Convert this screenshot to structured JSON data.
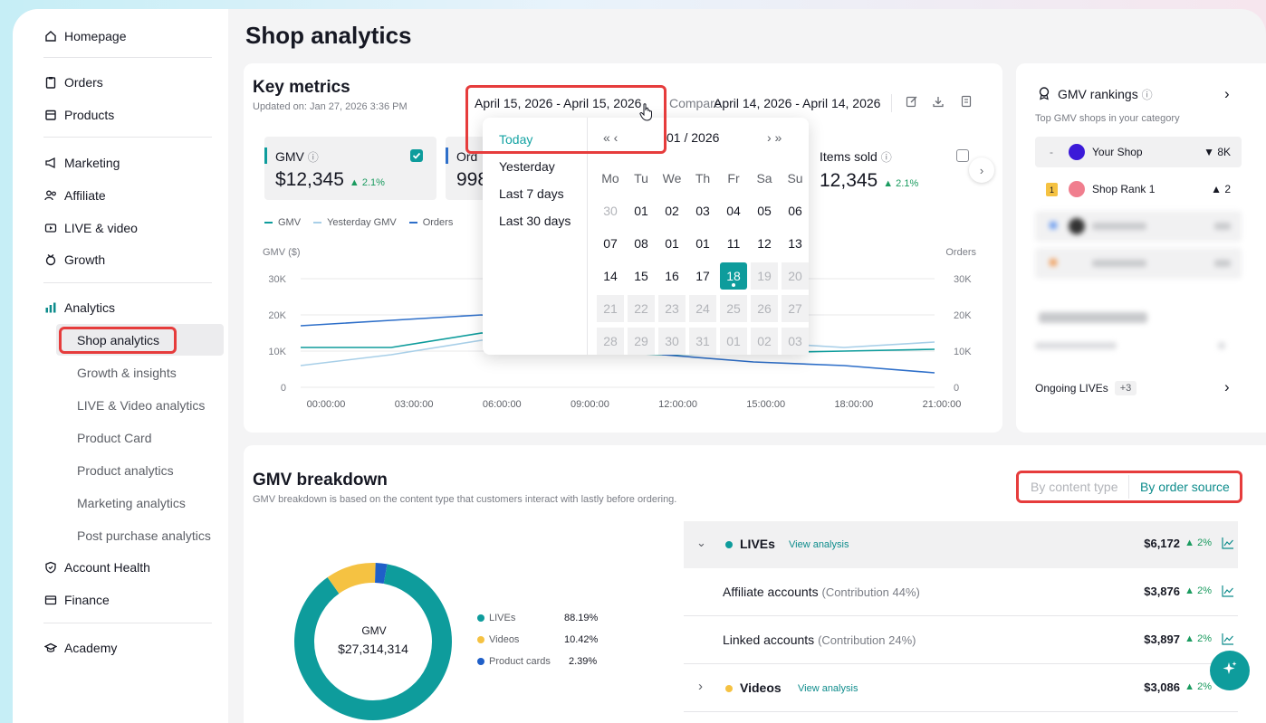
{
  "sidebar": {
    "homepage": "Homepage",
    "orders": "Orders",
    "products": "Products",
    "marketing": "Marketing",
    "affiliate": "Affiliate",
    "live_video": "LIVE & video",
    "growth": "Growth",
    "analytics": "Analytics",
    "analytics_items": [
      "Shop analytics",
      "Growth & insights",
      "LIVE & Video analytics",
      "Product Card",
      "Product analytics",
      "Marketing analytics",
      "Post purchase analytics"
    ],
    "account_health": "Account Health",
    "finance": "Finance",
    "academy": "Academy"
  },
  "page_title": "Shop analytics",
  "key_metrics": {
    "title": "Key metrics",
    "updated": "Updated on: Jan 27, 2026 3:36 PM",
    "date_range": "April 15, 2026 - April 15, 2026",
    "compare_label": "Compare",
    "compare_range": "April 14, 2026 - April 14, 2026",
    "gmv_label": "GMV",
    "gmv_value": "$12,345",
    "gmv_change": "▲ 2.1%",
    "orders_label": "Ord",
    "orders_value": "998",
    "items_label": "Items sold",
    "items_value": "12,345",
    "items_change": "▲ 2.1%",
    "legend": [
      "GMV",
      "Yesterday GMV",
      "Orders"
    ]
  },
  "chart_data": {
    "type": "line",
    "ylabel": "GMV ($)",
    "y2label": "Orders",
    "y_ticks": [
      "30K",
      "20K",
      "10K",
      "0"
    ],
    "y2_ticks": [
      "30K",
      "20K",
      "10K",
      "0"
    ],
    "ylim": [
      0,
      30000
    ],
    "x": [
      "00:00:00",
      "03:00:00",
      "06:00:00",
      "09:00:00",
      "12:00:00",
      "15:00:00",
      "18:00:00",
      "21:00:00"
    ],
    "series": [
      {
        "name": "GMV",
        "color": "#0e9c9c",
        "values": [
          11000,
          11000,
          15000,
          10000,
          9000,
          9500,
          10000,
          10500
        ]
      },
      {
        "name": "Yesterday GMV",
        "color": "#a8cfe8",
        "values": [
          6000,
          9000,
          13000,
          14000,
          13500,
          12500,
          11000,
          12500
        ]
      },
      {
        "name": "Orders",
        "color": "#2e6fc9",
        "values": [
          17000,
          18500,
          20000,
          14000,
          9000,
          7000,
          6000,
          4000
        ]
      }
    ]
  },
  "date_picker": {
    "quick_options": [
      "Today",
      "Yesterday",
      "Last 7 days",
      "Last 30 days"
    ],
    "nav_prev": "« ‹",
    "nav_next": "› »",
    "month": "01 / 2026",
    "weekdays": [
      "Mo",
      "Tu",
      "We",
      "Th",
      "Fr",
      "Sa",
      "Su"
    ],
    "rows": [
      [
        "30",
        "01",
        "02",
        "03",
        "04",
        "05",
        "06"
      ],
      [
        "07",
        "08",
        "01",
        "01",
        "11",
        "12",
        "13"
      ],
      [
        "14",
        "15",
        "16",
        "17",
        "18",
        "19",
        "20"
      ],
      [
        "21",
        "22",
        "23",
        "24",
        "25",
        "26",
        "27"
      ],
      [
        "28",
        "29",
        "30",
        "31",
        "01",
        "02",
        "03"
      ]
    ]
  },
  "gmv_rankings": {
    "title": "GMV rankings",
    "subtitle": "Top GMV shops in your category",
    "your_shop": "Your Shop",
    "your_shop_prefix": "-",
    "your_shop_change": "▼ 8K",
    "rank1": "Shop Rank 1",
    "rank1_badge": "1",
    "rank1_change": "▲ 2",
    "ongoing_lives": "Ongoing LIVEs",
    "ongoing_count": "+3"
  },
  "gmv_breakdown": {
    "title": "GMV breakdown",
    "subtitle": "GMV breakdown is based on the content type that customers interact with lastly before ordering.",
    "toggle_a": "By content type",
    "toggle_b": "By order source",
    "donut_title": "GMV",
    "donut_total": "$27,314,314",
    "legend": [
      {
        "label": "LIVEs",
        "pct": "88.19%",
        "color": "#0e9c9c"
      },
      {
        "label": "Videos",
        "pct": "10.42%",
        "color": "#f5c242"
      },
      {
        "label": "Product cards",
        "pct": "2.39%",
        "color": "#1f5fc8"
      }
    ],
    "rows": {
      "lives": {
        "label": "LIVEs",
        "link": "View analysis",
        "value": "$6,172",
        "change": "▲ 2%"
      },
      "affiliate": {
        "label": "Affiliate accounts",
        "contrib": "(Contribution 44%)",
        "value": "$3,876",
        "change": "▲ 2%"
      },
      "linked": {
        "label": "Linked accounts",
        "contrib": "(Contribution 24%)",
        "value": "$3,897",
        "change": "▲ 2%"
      },
      "videos": {
        "label": "Videos",
        "link": "View analysis",
        "value": "$3,086",
        "change": "▲ 2%"
      }
    }
  }
}
